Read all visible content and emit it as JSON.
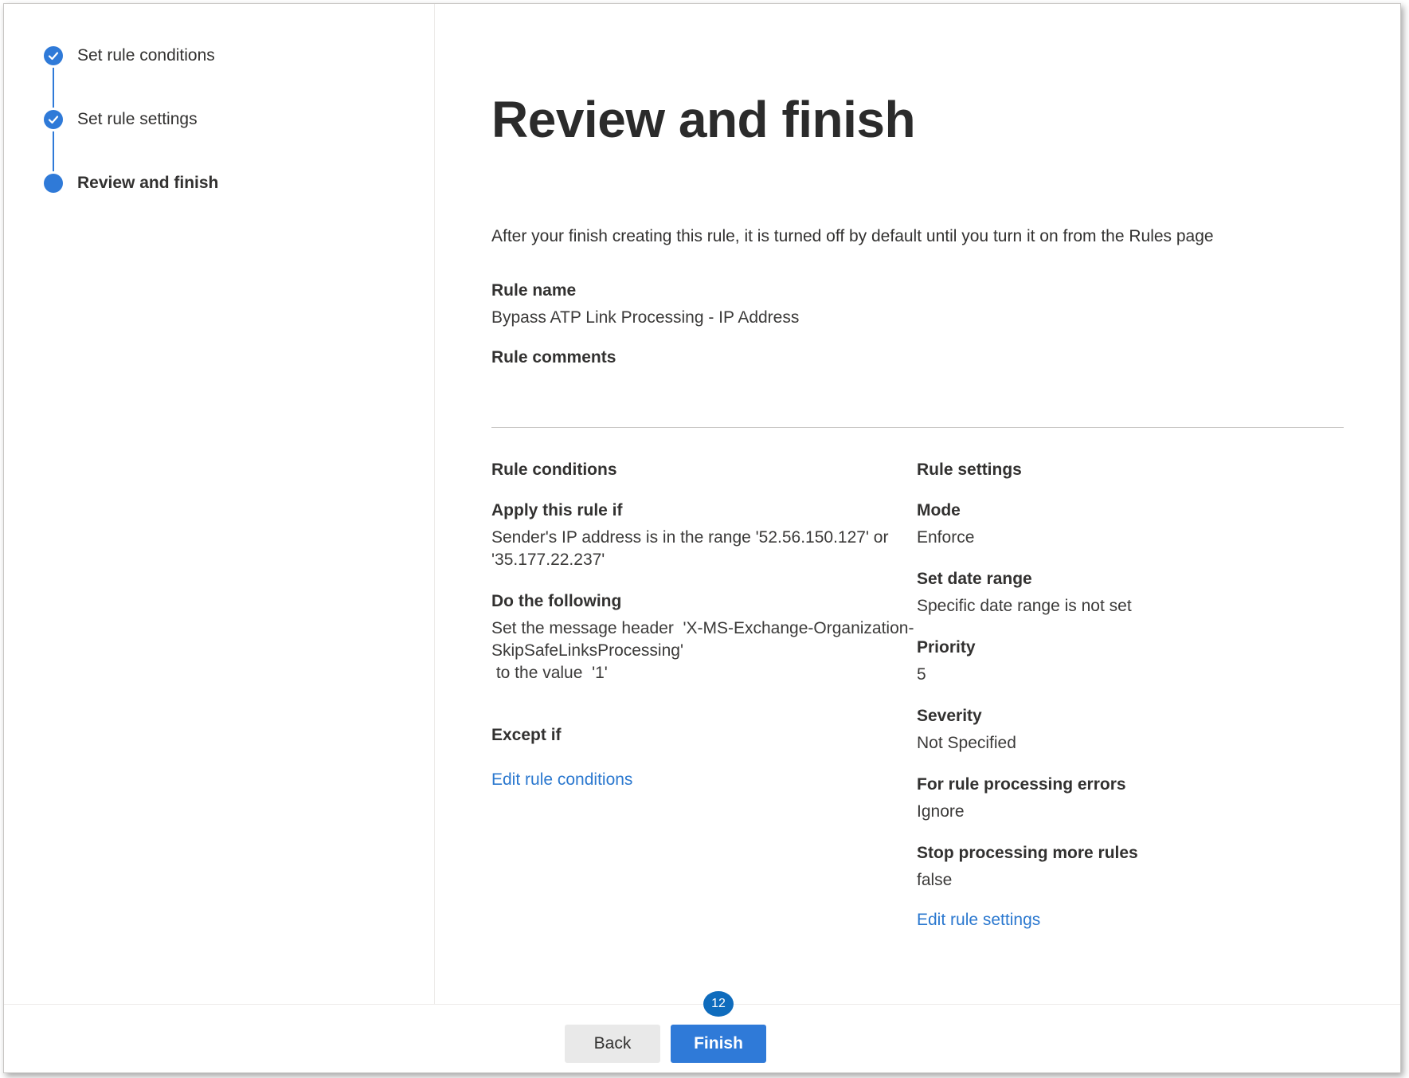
{
  "steps": [
    {
      "label": "Set rule conditions",
      "state": "done"
    },
    {
      "label": "Set rule settings",
      "state": "done"
    },
    {
      "label": "Review and finish",
      "state": "current"
    }
  ],
  "page_title": "Review and finish",
  "intro": "After your finish creating this rule, it is turned off by default until you turn it on from the Rules page",
  "rule_name": {
    "label": "Rule name",
    "value": "Bypass ATP Link Processing - IP Address"
  },
  "rule_comments": {
    "label": "Rule comments"
  },
  "conditions": {
    "heading": "Rule conditions",
    "apply_label": "Apply this rule if",
    "apply_line1": "Sender's IP address is in the range '52.56.150.127' or",
    "apply_line2": "'35.177.22.237'",
    "do_label": "Do the following",
    "do_line1": "Set the message header  'X-MS-Exchange-Organization-",
    "do_line2": "SkipSafeLinksProcessing'",
    "do_line3": " to the value  '1'",
    "except_label": "Except if",
    "edit_link": "Edit rule conditions"
  },
  "settings": {
    "heading": "Rule settings",
    "mode_label": "Mode",
    "mode_value": "Enforce",
    "date_label": "Set date range",
    "date_value": "Specific date range is not set",
    "priority_label": "Priority",
    "priority_value": "5",
    "severity_label": "Severity",
    "severity_value": "Not Specified",
    "errors_label": "For rule processing errors",
    "errors_value": "Ignore",
    "stop_label": "Stop processing more rules",
    "stop_value": "false",
    "edit_link": "Edit rule settings"
  },
  "footer": {
    "back_label": "Back",
    "finish_label": "Finish",
    "badge": "12"
  },
  "colors": {
    "accent": "#2f7ad8",
    "link": "#2b78cf",
    "badge": "#0f6cbd"
  }
}
